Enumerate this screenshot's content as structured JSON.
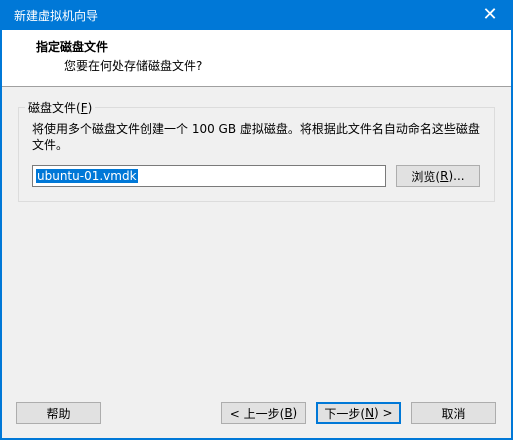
{
  "window": {
    "title": "新建虚拟机向导",
    "close_glyph": "✕"
  },
  "header": {
    "title": "指定磁盘文件",
    "subtitle": "您要在何处存储磁盘文件?"
  },
  "disk_file": {
    "group_label_prefix": "磁盘文件(",
    "group_label_key": "F",
    "group_label_suffix": ")",
    "description": "将使用多个磁盘文件创建一个 100 GB 虚拟磁盘。将根据此文件名自动命名这些磁盘文件。",
    "filename_value": "ubuntu-01.vmdk",
    "browse_prefix": "浏览(",
    "browse_key": "R",
    "browse_suffix": ")..."
  },
  "footer": {
    "help_label": "帮助",
    "back_prefix": "< 上一步(",
    "back_key": "B",
    "back_suffix": ")",
    "next_prefix": "下一步(",
    "next_key": "N",
    "next_suffix": ") >",
    "cancel_label": "取消"
  },
  "colors": {
    "accent": "#0078d7",
    "window_bg": "#f0f0f0",
    "button_bg": "#e1e1e1"
  }
}
